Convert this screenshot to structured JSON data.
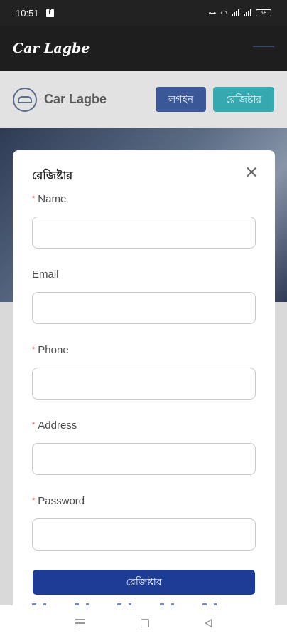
{
  "status_bar": {
    "time": "10:51",
    "battery": "58"
  },
  "app_bar": {
    "title": "Car Lagbe"
  },
  "header": {
    "brand": "Car Lagbe",
    "login_label": "লগইন",
    "register_label": "রেজিষ্টার"
  },
  "modal": {
    "title": "রেজিষ্টার",
    "fields": [
      {
        "label": "Name",
        "required": true,
        "value": ""
      },
      {
        "label": "Email",
        "required": false,
        "value": ""
      },
      {
        "label": "Phone",
        "required": true,
        "value": ""
      },
      {
        "label": "Address",
        "required": true,
        "value": ""
      },
      {
        "label": "Password",
        "required": true,
        "value": ""
      }
    ],
    "required_mark": "*",
    "submit_label": "রেজিষ্টার"
  },
  "icons": {
    "close": "close-icon",
    "logo": "car-logo-icon",
    "nav_menu": "menu-icon",
    "nav_home": "home-icon",
    "nav_back": "back-icon"
  },
  "colors": {
    "primary": "#1d3c94",
    "teal": "#18a0a8",
    "required": "#e05050"
  }
}
